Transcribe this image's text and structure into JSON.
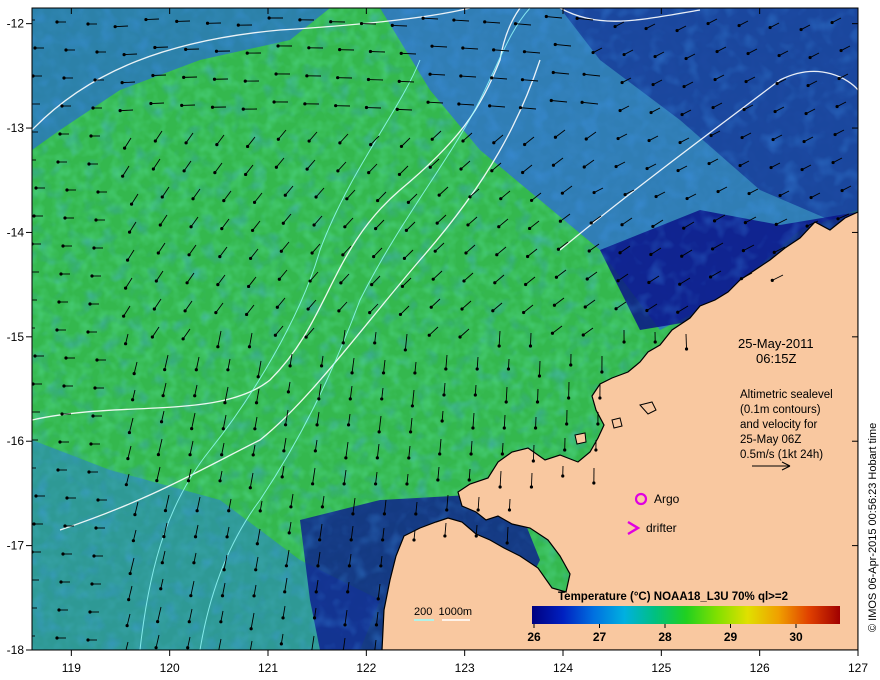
{
  "map": {
    "lon_range": [
      118.6,
      127
    ],
    "lat_range": [
      -18,
      -11.85
    ],
    "x_ticks": [
      119,
      120,
      121,
      122,
      123,
      124,
      125,
      126,
      127
    ],
    "y_ticks": [
      -12,
      -13,
      -14,
      -15,
      -16,
      -17,
      -18
    ],
    "colors": {
      "land": "#f9c8a0",
      "sea_cold": "#0a1a8a",
      "sea_mid": "#2fbf4a",
      "sea_blue": "#2a70c8",
      "contour": "#ffffff",
      "arrow": "#000000",
      "marker": "#e000e0"
    }
  },
  "info": {
    "date": "25-May-2011",
    "time": "06:15Z",
    "desc_lines": [
      "Altimetric sealevel",
      "(0.1m contours)",
      "and velocity for",
      "25-May 06Z",
      "0.5m/s (1kt 24h)"
    ]
  },
  "legend": {
    "argo_label": "Argo",
    "drifter_label": "drifter",
    "bathy_label": "200  1000m"
  },
  "colorbar": {
    "title": "Temperature (°C) NOAA18_L3U 70% ql>=2",
    "ticks": [
      "26",
      "27",
      "28",
      "29",
      "30"
    ],
    "stops": [
      "#000080",
      "#0020c0",
      "#0070e0",
      "#00b0e0",
      "#00c080",
      "#20d020",
      "#80e000",
      "#e0e000",
      "#f0a000",
      "#e04000",
      "#a00000"
    ]
  },
  "credit": "© IMOS 06-Apr-2015 00:56:23 Hobart time"
}
